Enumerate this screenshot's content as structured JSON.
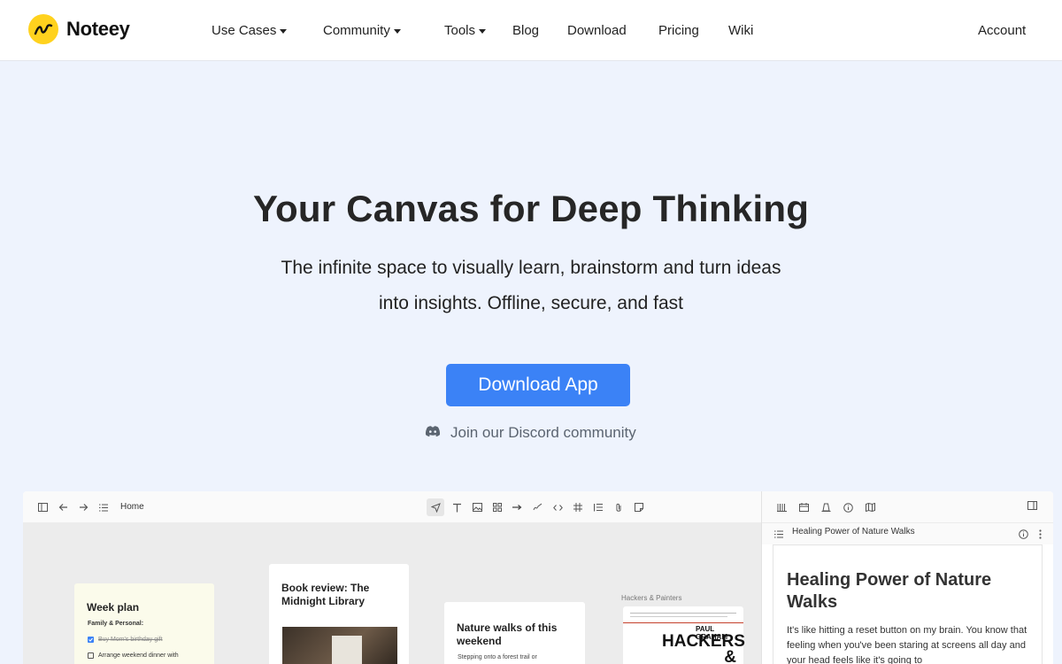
{
  "brand": {
    "name": "Noteey"
  },
  "nav": {
    "use_cases": "Use Cases",
    "community": "Community",
    "tools": "Tools",
    "blog": "Blog",
    "download": "Download",
    "pricing": "Pricing",
    "wiki": "Wiki",
    "account": "Account"
  },
  "hero": {
    "title": "Your Canvas for Deep Thinking",
    "subtitle_line1": "The infinite space to visually learn, brainstorm and turn ideas",
    "subtitle_line2": "into insights. Offline, secure, and fast",
    "cta": "Download App",
    "discord": "Join our Discord community"
  },
  "app": {
    "breadcrumb": "Home",
    "panel_title": "Healing Power of Nature Walks",
    "doc_title": "Healing Power of Nature Walks",
    "doc_body": "It's like hitting a reset button on my brain. You know that feeling when you've been staring at screens all day and your head feels like it's going to",
    "cards": {
      "week_plan": {
        "title": "Week plan",
        "section": "Family & Personal:",
        "task1": "Buy Mom's birthday gift",
        "task2": "Arrange weekend dinner with"
      },
      "book_review": {
        "title": "Book review: The Midnight Library"
      },
      "nature": {
        "title": "Nature walks of this weekend",
        "excerpt": "Stepping onto a forest trail or"
      },
      "hackers": {
        "label": "Hackers & Painters",
        "author": "PAUL GRAHAM",
        "cover_title": "HACKERS & PAINTERS"
      }
    }
  },
  "colors": {
    "accent": "#3b82f6",
    "logo": "#ffd21e",
    "background": "#eef3fd"
  }
}
